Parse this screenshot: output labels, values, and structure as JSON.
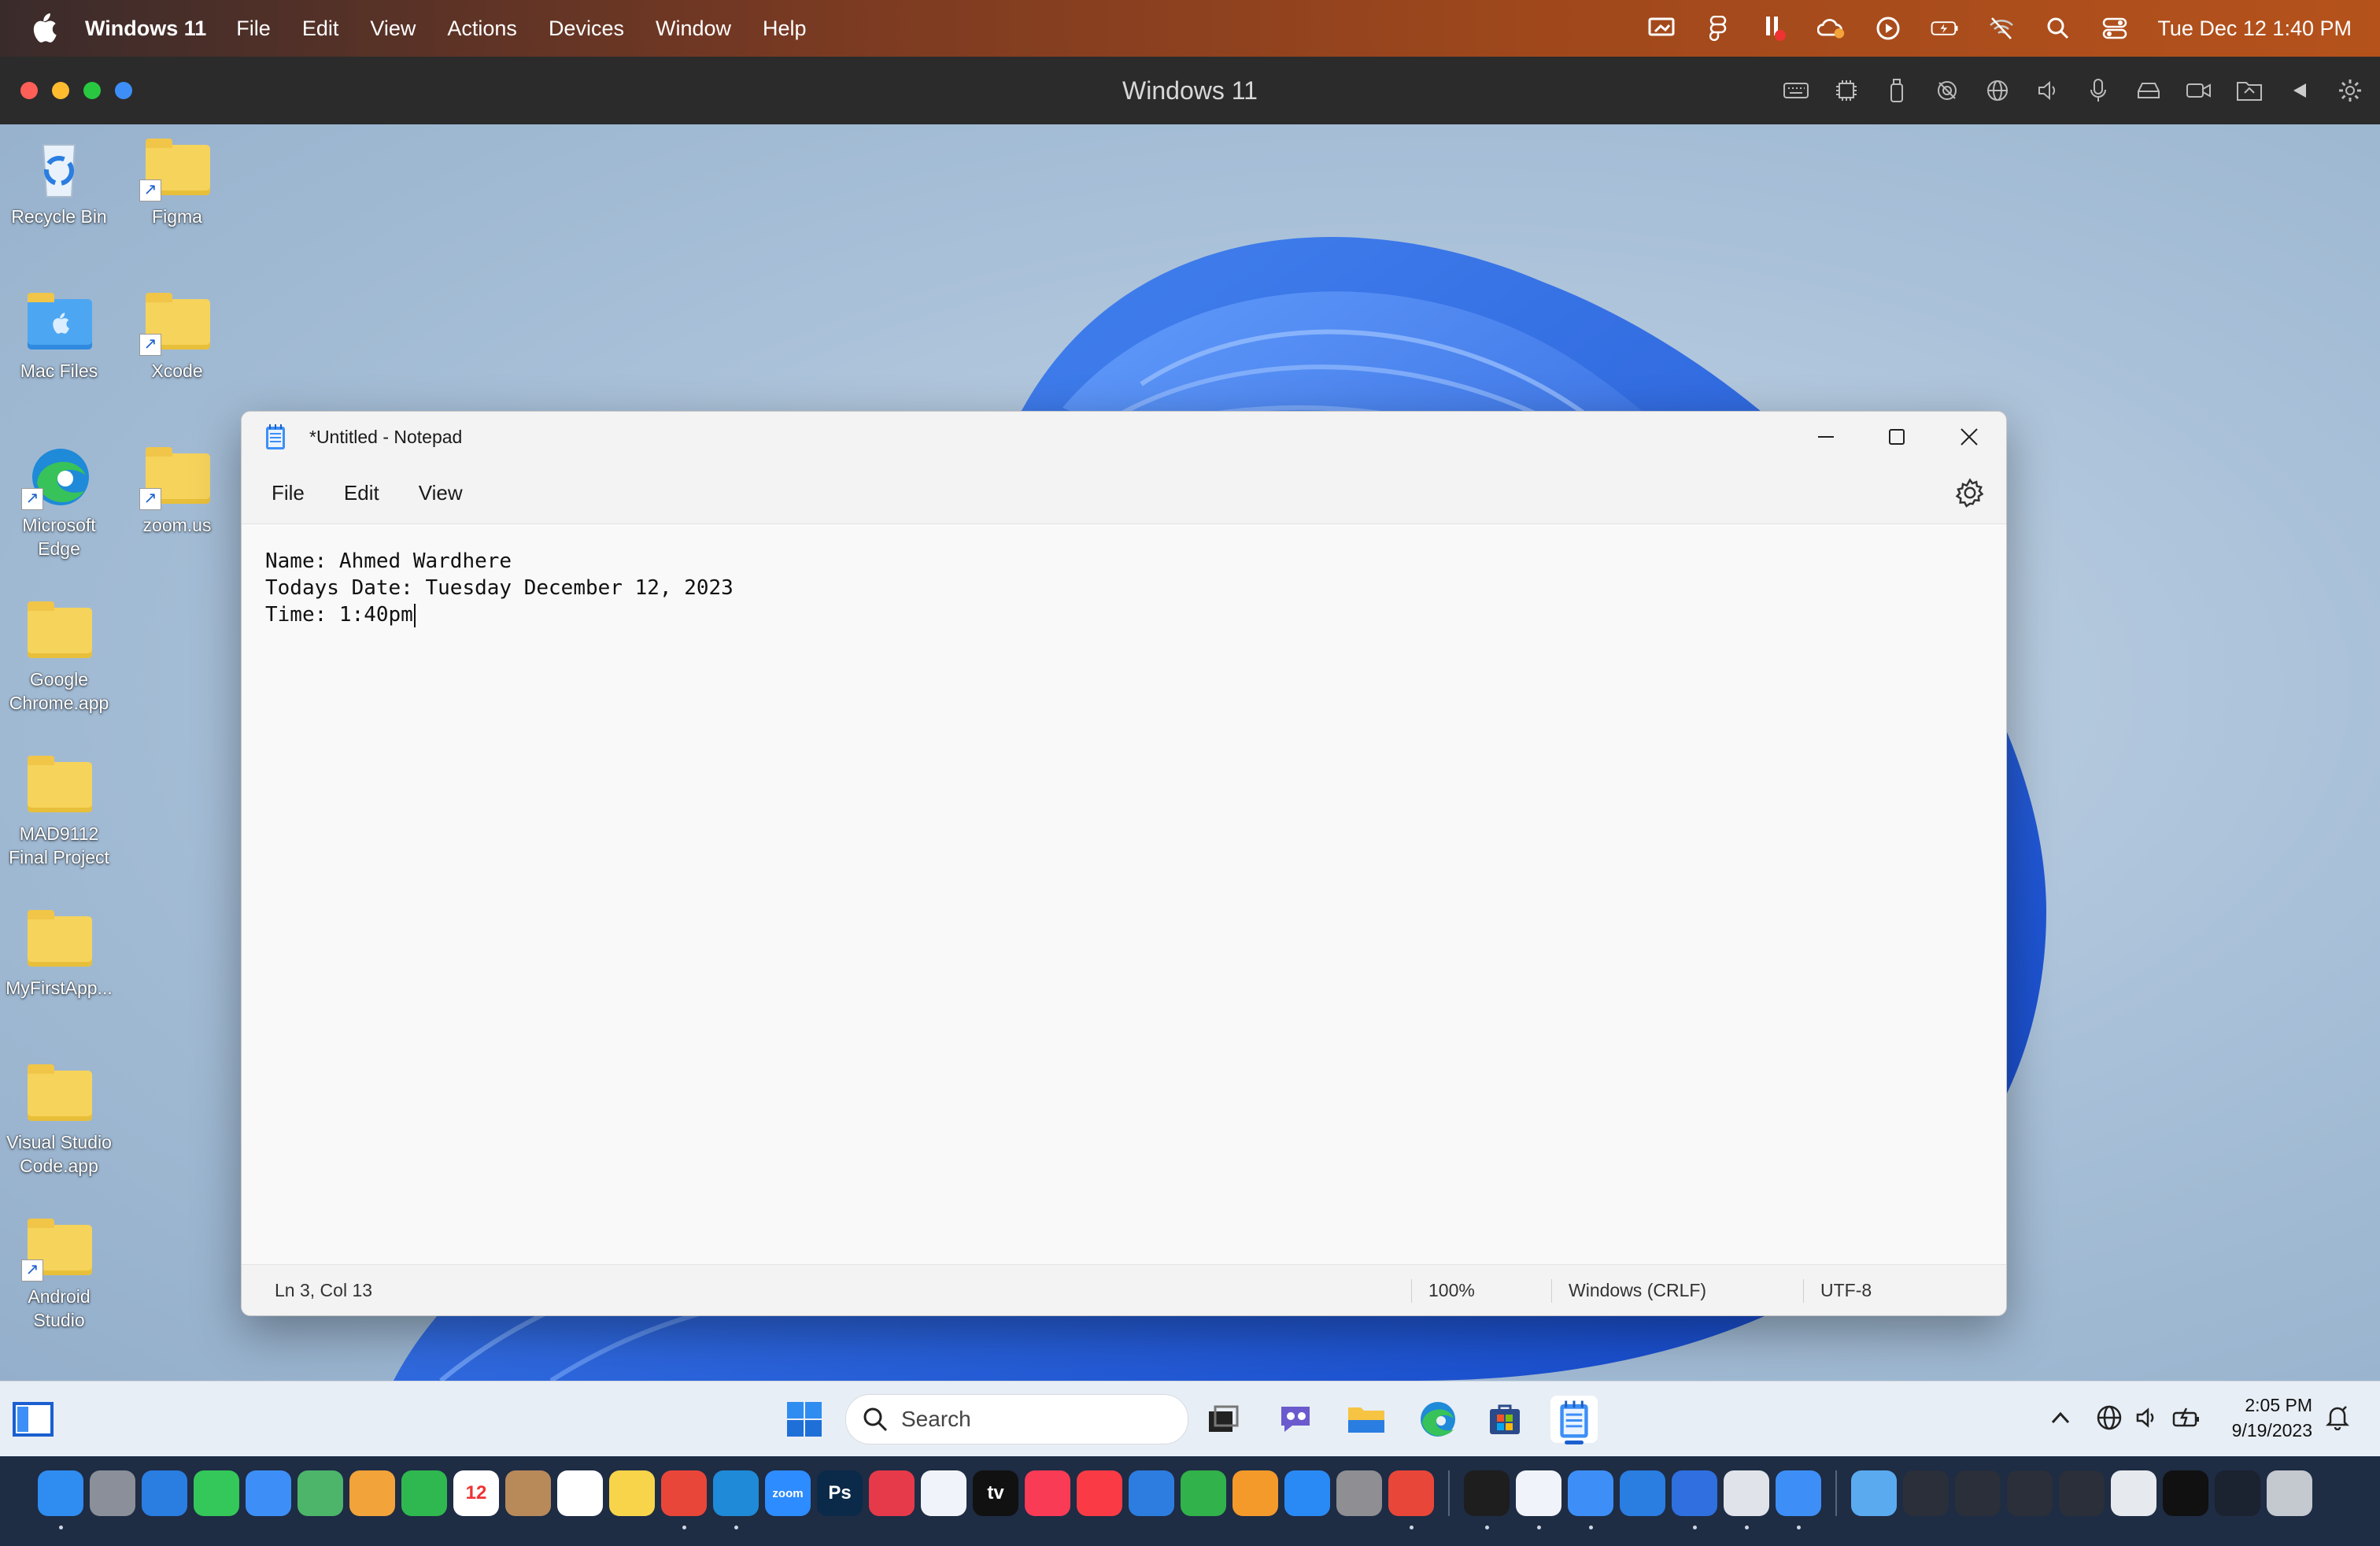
{
  "mac_menubar": {
    "app_name": "Windows 11",
    "items": [
      "File",
      "Edit",
      "View",
      "Actions",
      "Devices",
      "Window",
      "Help"
    ],
    "clock": "Tue Dec 12  1:40 PM"
  },
  "vm_window": {
    "title": "Windows 11"
  },
  "desktop_icons": [
    {
      "label": "Recycle Bin"
    },
    {
      "label": "Figma"
    },
    {
      "label": "Mac Files"
    },
    {
      "label": "Xcode"
    },
    {
      "label": "Microsoft Edge"
    },
    {
      "label": "zoom.us"
    },
    {
      "label": "Google Chrome.app"
    },
    {
      "label": "MAD9112 Final Project"
    },
    {
      "label": "MyFirstApp..."
    },
    {
      "label": "Visual Studio Code.app"
    },
    {
      "label": "Android Studio"
    }
  ],
  "notepad": {
    "title": "*Untitled - Notepad",
    "menu": [
      "File",
      "Edit",
      "View"
    ],
    "lines": [
      "Name: Ahmed Wardhere",
      "Todays Date: Tuesday December 12, 2023",
      "Time: 1:40pm"
    ],
    "status": {
      "position": "Ln 3, Col 13",
      "zoom": "100%",
      "line_ending": "Windows (CRLF)",
      "encoding": "UTF-8"
    }
  },
  "taskbar": {
    "search_placeholder": "Search",
    "time": "2:05 PM",
    "date": "9/19/2023",
    "apps": [
      "start-icon",
      "search",
      "task-view-icon",
      "chat-icon",
      "file-explorer-icon",
      "edge-icon",
      "store-icon",
      "notepad-icon"
    ]
  },
  "dock": {
    "apps": [
      {
        "name": "finder",
        "color": "#2f8cf0"
      },
      {
        "name": "launchpad",
        "color": "#8a8f99"
      },
      {
        "name": "safari",
        "color": "#2a7de1"
      },
      {
        "name": "messages",
        "color": "#34c759"
      },
      {
        "name": "mail",
        "color": "#3d8ff7"
      },
      {
        "name": "maps",
        "color": "#4cb56a"
      },
      {
        "name": "photos",
        "color": "#f2a33a"
      },
      {
        "name": "facetime",
        "color": "#2fb84f"
      },
      {
        "name": "calendar",
        "color": "#ffffff",
        "text": "12"
      },
      {
        "name": "contacts",
        "color": "#b88a5a"
      },
      {
        "name": "reminders",
        "color": "#ffffff"
      },
      {
        "name": "notes",
        "color": "#f7d44a"
      },
      {
        "name": "chrome",
        "color": "#e9463a"
      },
      {
        "name": "vscode",
        "color": "#1f8ad8"
      },
      {
        "name": "zoom",
        "color": "#2d8cff",
        "text": "zoom"
      },
      {
        "name": "photoshop",
        "color": "#0b2a4a",
        "text": "Ps"
      },
      {
        "name": "creative-cloud",
        "color": "#e63a4a"
      },
      {
        "name": "freeform",
        "color": "#f0f4fa"
      },
      {
        "name": "apple-tv",
        "color": "#111111",
        "text": "tv"
      },
      {
        "name": "music",
        "color": "#fa3b55"
      },
      {
        "name": "news",
        "color": "#fa3b45"
      },
      {
        "name": "keynote",
        "color": "#2d7de0"
      },
      {
        "name": "numbers",
        "color": "#31b24a"
      },
      {
        "name": "pages",
        "color": "#f39a2a"
      },
      {
        "name": "app-store",
        "color": "#2a8af5"
      },
      {
        "name": "system-settings",
        "color": "#8e8e93"
      },
      {
        "name": "chrome-2",
        "color": "#e9463a"
      },
      {
        "name": "figma",
        "color": "#1e1e1e"
      },
      {
        "name": "xcode-instruments",
        "color": "#f0f4fa"
      },
      {
        "name": "xcode",
        "color": "#3d8ff7"
      },
      {
        "name": "xcode-2",
        "color": "#2a7de1"
      },
      {
        "name": "windows",
        "color": "#2f6fe0"
      },
      {
        "name": "parallels",
        "color": "#e0e4ea"
      },
      {
        "name": "notepad",
        "color": "#3d8ff7"
      },
      {
        "name": "folder",
        "color": "#5aaaf0"
      },
      {
        "name": "recent-1",
        "color": "#2a2f3a"
      },
      {
        "name": "recent-2",
        "color": "#2a2f3a"
      },
      {
        "name": "recent-3",
        "color": "#2a2f3a"
      },
      {
        "name": "recent-4",
        "color": "#2a2f3a"
      },
      {
        "name": "recent-5",
        "color": "#e6e9ee"
      },
      {
        "name": "recent-6",
        "color": "#111111"
      },
      {
        "name": "recent-7",
        "color": "#1b2230"
      },
      {
        "name": "trash",
        "color": "#c4c8cf"
      }
    ]
  }
}
